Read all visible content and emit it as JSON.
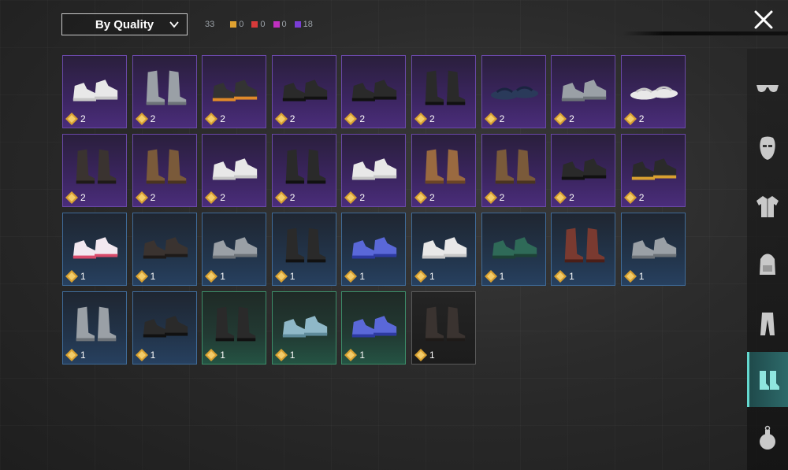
{
  "colors": {
    "purple": "#6a48a8",
    "blue": "#3f6b99",
    "green": "#3c8c68",
    "accent": "#64d8cf",
    "legendary": "#e0a230",
    "mythic": "#d83a3a",
    "epic_pink": "#c030c0",
    "epic": "#7a3dd6"
  },
  "sort_dropdown": {
    "label": "By Quality",
    "icon": "chevron-down-icon"
  },
  "counts": {
    "total": "33",
    "items": [
      {
        "color": "#e0a230",
        "value": "0"
      },
      {
        "color": "#d83a3a",
        "value": "0"
      },
      {
        "color": "#c030c0",
        "value": "0"
      },
      {
        "color": "#7a3dd6",
        "value": "18"
      }
    ]
  },
  "close": {
    "icon": "close-icon"
  },
  "sidebar": [
    {
      "icon": "glasses-icon",
      "active": false
    },
    {
      "icon": "mask-icon",
      "active": false
    },
    {
      "icon": "jacket-icon",
      "active": false
    },
    {
      "icon": "backpack-icon",
      "active": false
    },
    {
      "icon": "pants-icon",
      "active": false
    },
    {
      "icon": "shoes-icon",
      "active": true
    },
    {
      "icon": "grenade-icon",
      "active": false
    }
  ],
  "items": [
    {
      "rarity": "purple",
      "qty": "2",
      "shoe": "sneaker-white"
    },
    {
      "rarity": "purple",
      "qty": "2",
      "shoe": "boot-grey"
    },
    {
      "rarity": "purple",
      "qty": "2",
      "shoe": "sneaker-black-orange"
    },
    {
      "rarity": "purple",
      "qty": "2",
      "shoe": "sneaker-black"
    },
    {
      "rarity": "purple",
      "qty": "2",
      "shoe": "loafer-black"
    },
    {
      "rarity": "purple",
      "qty": "2",
      "shoe": "boot-black"
    },
    {
      "rarity": "purple",
      "qty": "2",
      "shoe": "sandal-flip"
    },
    {
      "rarity": "purple",
      "qty": "2",
      "shoe": "sneaker-grey"
    },
    {
      "rarity": "purple",
      "qty": "2",
      "shoe": "sandal-white"
    },
    {
      "rarity": "purple",
      "qty": "2",
      "shoe": "boot-dark"
    },
    {
      "rarity": "purple",
      "qty": "2",
      "shoe": "boot-brown"
    },
    {
      "rarity": "purple",
      "qty": "2",
      "shoe": "sneaker-white-socks"
    },
    {
      "rarity": "purple",
      "qty": "2",
      "shoe": "tall-boot-black"
    },
    {
      "rarity": "purple",
      "qty": "2",
      "shoe": "sneaker-blue-white"
    },
    {
      "rarity": "purple",
      "qty": "2",
      "shoe": "boot-tan"
    },
    {
      "rarity": "purple",
      "qty": "2",
      "shoe": "tall-boot-brown"
    },
    {
      "rarity": "purple",
      "qty": "2",
      "shoe": "sneaker-nike-black"
    },
    {
      "rarity": "purple",
      "qty": "2",
      "shoe": "sneaker-black-gold"
    },
    {
      "rarity": "blue",
      "qty": "1",
      "shoe": "sneaker-floral"
    },
    {
      "rarity": "blue",
      "qty": "1",
      "shoe": "sneaker-low-dark"
    },
    {
      "rarity": "blue",
      "qty": "1",
      "shoe": "shoe-dark-grey"
    },
    {
      "rarity": "blue",
      "qty": "1",
      "shoe": "tall-boot-black"
    },
    {
      "rarity": "blue",
      "qty": "1",
      "shoe": "sneaker-blue"
    },
    {
      "rarity": "blue",
      "qty": "1",
      "shoe": "slip-on-white"
    },
    {
      "rarity": "blue",
      "qty": "1",
      "shoe": "shoe-green"
    },
    {
      "rarity": "blue",
      "qty": "1",
      "shoe": "boot-red"
    },
    {
      "rarity": "blue",
      "qty": "1",
      "shoe": "shoe-dark-grey"
    },
    {
      "rarity": "blue",
      "qty": "1",
      "shoe": "boot-grey-short"
    },
    {
      "rarity": "blue",
      "qty": "1",
      "shoe": "shoe-black"
    },
    {
      "rarity": "green",
      "qty": "1",
      "shoe": "boot-black-laced"
    },
    {
      "rarity": "green",
      "qty": "1",
      "shoe": "sneaker-light-blue"
    },
    {
      "rarity": "green",
      "qty": "1",
      "shoe": "sneaker-low-blue"
    },
    {
      "rarity": "dark",
      "qty": "1",
      "shoe": "boot-brown-dark"
    }
  ]
}
